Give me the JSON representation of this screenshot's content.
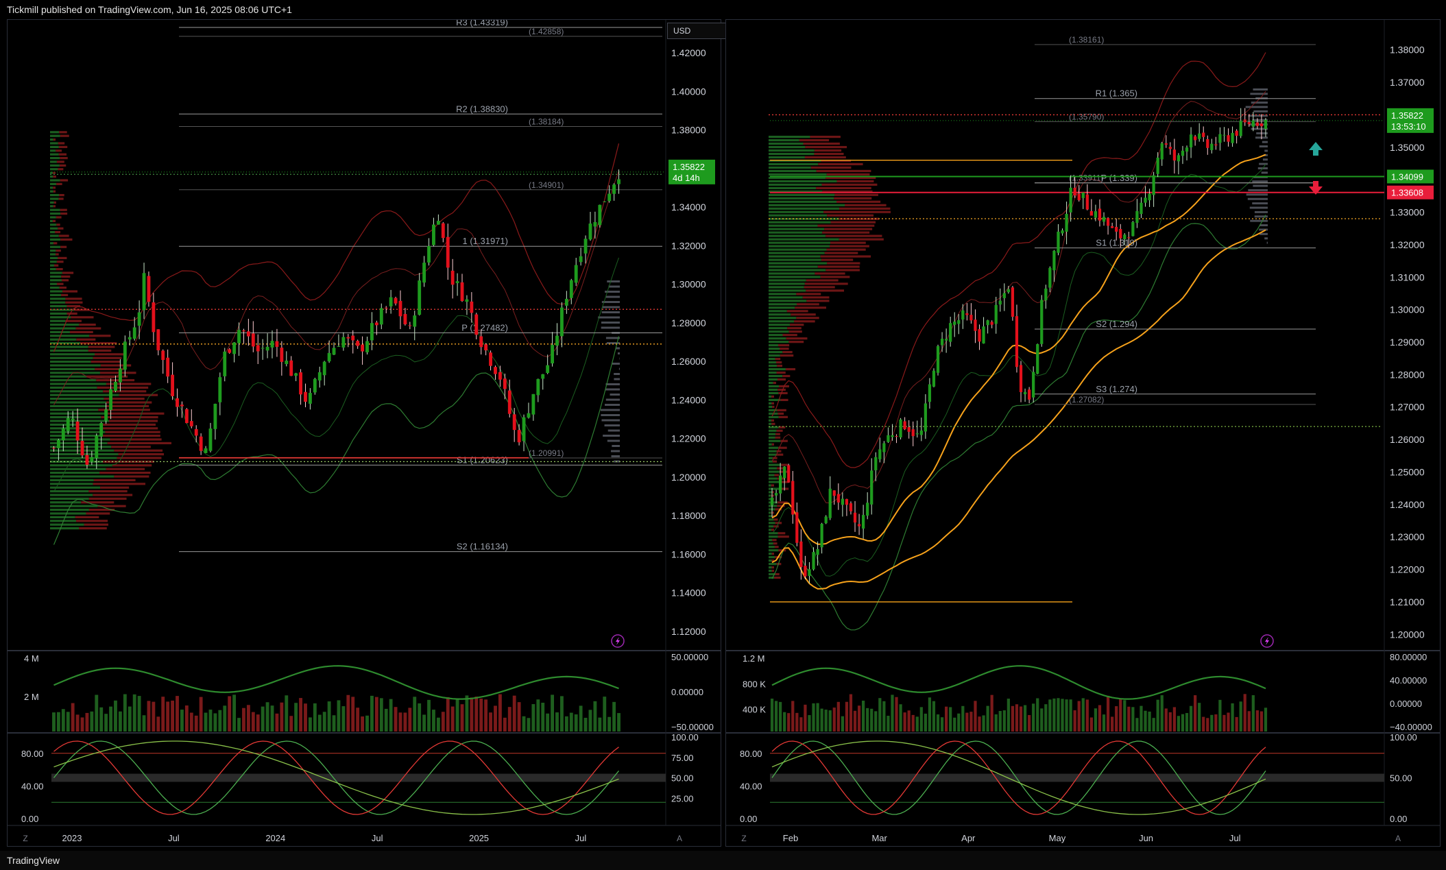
{
  "header": {
    "text": "Tickmill published on TradingView.com, Jun 16, 2025 08:06 UTC+1"
  },
  "footer": {
    "logo_text": "TradingView",
    "logo_icon": "tradingview-logo-icon"
  },
  "colors": {
    "bull": "#1e9b1e",
    "bear": "#e3101b",
    "green_band": "#2e7d32",
    "red_band": "#8b1a1a",
    "orange": "#f7a21b",
    "price_tag": "#1e9b1e",
    "red_tag": "#e91e3b"
  },
  "left": {
    "currency": "USD",
    "price_axis": [
      "1.42000",
      "1.40000",
      "1.38000",
      "1.36000",
      "1.34000",
      "1.32000",
      "1.30000",
      "1.28000",
      "1.26000",
      "1.24000",
      "1.22000",
      "1.20000",
      "1.18000",
      "1.16000",
      "1.14000",
      "1.12000"
    ],
    "time_axis": [
      "2023",
      "Jul",
      "2024",
      "Jul",
      "2025",
      "Jul"
    ],
    "time_axis_corners": [
      "Z",
      "A"
    ],
    "last_price": "1.35822",
    "countdown": "4d 14h",
    "pivot_labels": [
      {
        "text": "R3 (1.43319)",
        "price": 1.43319
      },
      {
        "text": "(1.42858)",
        "price": 1.42858
      },
      {
        "text": "R2 (1.38830)",
        "price": 1.3883
      },
      {
        "text": "(1.38184)",
        "price": 1.38184
      },
      {
        "text": "(1.34901)",
        "price": 1.34901
      },
      {
        "text": "1 (1.31971)",
        "price": 1.31971
      },
      {
        "text": "P (1.27482)",
        "price": 1.27482
      },
      {
        "text": "(1.20991)",
        "price": 1.20991
      },
      {
        "text": "S1 (1.20623)",
        "price": 1.20623
      },
      {
        "text": "S2 (1.16134)",
        "price": 1.16134
      }
    ],
    "volume_axis": [
      "4 M",
      "2 M"
    ],
    "oscillator_axis": [
      "50.00000",
      "0.00000",
      "−50.00000"
    ],
    "stoch_left_axis": [
      "80.00",
      "40.00",
      "0.00"
    ],
    "stoch_right_axis": [
      "100.00",
      "75.00",
      "50.00",
      "25.00"
    ]
  },
  "right": {
    "price_axis": [
      "1.38000",
      "1.37000",
      "1.36000",
      "1.35000",
      "1.34000",
      "1.33000",
      "1.32000",
      "1.31000",
      "1.30000",
      "1.29000",
      "1.28000",
      "1.27000",
      "1.26000",
      "1.25000",
      "1.24000",
      "1.23000",
      "1.22000",
      "1.21000",
      "1.20000"
    ],
    "time_axis": [
      "Feb",
      "Mar",
      "Apr",
      "May",
      "Jun",
      "Jul"
    ],
    "time_axis_corners": [
      "Z",
      "A"
    ],
    "last_price": "1.35822",
    "countdown": "13:53:10",
    "level_green": "1.34099",
    "level_red": "1.33608",
    "pivot_labels": [
      {
        "text": "(1.38161)",
        "price": 1.38161
      },
      {
        "text": "R1 (1.365)",
        "price": 1.365
      },
      {
        "text": "(1.35790)",
        "price": 1.3579
      },
      {
        "text": "(1.33911)",
        "price": 1.33911
      },
      {
        "text": "P (1.339)",
        "price": 1.339
      },
      {
        "text": "S1 (1.319)",
        "price": 1.319
      },
      {
        "text": "S2 (1.294)",
        "price": 1.294
      },
      {
        "text": "S3 (1.274)",
        "price": 1.274
      },
      {
        "text": "(1.27082)",
        "price": 1.27082
      }
    ],
    "volume_axis": [
      "1.2 M",
      "800 K",
      "400 K"
    ],
    "oscillator_axis": [
      "80.00000",
      "40.00000",
      "0.00000",
      "−40.00000"
    ],
    "stoch_left_axis": [
      "80.00",
      "40.00",
      "0.00"
    ],
    "stoch_right_axis": [
      "100.00",
      "50.00",
      "0.00"
    ]
  },
  "chart_data": [
    {
      "type": "candlestick",
      "title": "",
      "x_ticks": [
        "2023",
        "Jul",
        "2024",
        "Jul",
        "2025",
        "Jul"
      ],
      "ylim": [
        1.11,
        1.43
      ],
      "close_path": [
        {
          "t": 0.0,
          "c": 1.215
        },
        {
          "t": 0.03,
          "c": 1.232
        },
        {
          "t": 0.06,
          "c": 1.206
        },
        {
          "t": 0.09,
          "c": 1.235
        },
        {
          "t": 0.12,
          "c": 1.262
        },
        {
          "t": 0.15,
          "c": 1.285
        },
        {
          "t": 0.16,
          "c": 1.303
        },
        {
          "t": 0.18,
          "c": 1.272
        },
        {
          "t": 0.21,
          "c": 1.245
        },
        {
          "t": 0.24,
          "c": 1.228
        },
        {
          "t": 0.27,
          "c": 1.212
        },
        {
          "t": 0.3,
          "c": 1.262
        },
        {
          "t": 0.33,
          "c": 1.278
        },
        {
          "t": 0.36,
          "c": 1.265
        },
        {
          "t": 0.39,
          "c": 1.27
        },
        {
          "t": 0.42,
          "c": 1.255
        },
        {
          "t": 0.45,
          "c": 1.238
        },
        {
          "t": 0.48,
          "c": 1.262
        },
        {
          "t": 0.51,
          "c": 1.273
        },
        {
          "t": 0.54,
          "c": 1.265
        },
        {
          "t": 0.57,
          "c": 1.28
        },
        {
          "t": 0.6,
          "c": 1.292
        },
        {
          "t": 0.63,
          "c": 1.275
        },
        {
          "t": 0.66,
          "c": 1.318
        },
        {
          "t": 0.68,
          "c": 1.338
        },
        {
          "t": 0.7,
          "c": 1.305
        },
        {
          "t": 0.73,
          "c": 1.292
        },
        {
          "t": 0.76,
          "c": 1.268
        },
        {
          "t": 0.79,
          "c": 1.252
        },
        {
          "t": 0.82,
          "c": 1.218
        },
        {
          "t": 0.85,
          "c": 1.245
        },
        {
          "t": 0.88,
          "c": 1.262
        },
        {
          "t": 0.91,
          "c": 1.298
        },
        {
          "t": 0.94,
          "c": 1.325
        },
        {
          "t": 0.97,
          "c": 1.342
        },
        {
          "t": 1.0,
          "c": 1.35822
        }
      ]
    },
    {
      "type": "candlestick",
      "title": "",
      "x_ticks": [
        "Feb",
        "Mar",
        "Apr",
        "May",
        "Jun",
        "Jul"
      ],
      "ylim": [
        1.195,
        1.385
      ],
      "close_path": [
        {
          "t": 0.0,
          "c": 1.24
        },
        {
          "t": 0.03,
          "c": 1.252
        },
        {
          "t": 0.06,
          "c": 1.218
        },
        {
          "t": 0.09,
          "c": 1.225
        },
        {
          "t": 0.12,
          "c": 1.245
        },
        {
          "t": 0.15,
          "c": 1.238
        },
        {
          "t": 0.18,
          "c": 1.232
        },
        {
          "t": 0.21,
          "c": 1.255
        },
        {
          "t": 0.24,
          "c": 1.262
        },
        {
          "t": 0.27,
          "c": 1.265
        },
        {
          "t": 0.3,
          "c": 1.26
        },
        {
          "t": 0.33,
          "c": 1.285
        },
        {
          "t": 0.36,
          "c": 1.295
        },
        {
          "t": 0.39,
          "c": 1.298
        },
        {
          "t": 0.42,
          "c": 1.292
        },
        {
          "t": 0.45,
          "c": 1.298
        },
        {
          "t": 0.48,
          "c": 1.308
        },
        {
          "t": 0.5,
          "c": 1.278
        },
        {
          "t": 0.52,
          "c": 1.272
        },
        {
          "t": 0.55,
          "c": 1.305
        },
        {
          "t": 0.58,
          "c": 1.322
        },
        {
          "t": 0.61,
          "c": 1.338
        },
        {
          "t": 0.64,
          "c": 1.332
        },
        {
          "t": 0.67,
          "c": 1.328
        },
        {
          "t": 0.7,
          "c": 1.322
        },
        {
          "t": 0.73,
          "c": 1.325
        },
        {
          "t": 0.76,
          "c": 1.335
        },
        {
          "t": 0.79,
          "c": 1.352
        },
        {
          "t": 0.82,
          "c": 1.345
        },
        {
          "t": 0.85,
          "c": 1.355
        },
        {
          "t": 0.88,
          "c": 1.35
        },
        {
          "t": 0.91,
          "c": 1.352
        },
        {
          "t": 0.94,
          "c": 1.355
        },
        {
          "t": 0.97,
          "c": 1.358
        },
        {
          "t": 1.0,
          "c": 1.35822
        }
      ]
    }
  ]
}
